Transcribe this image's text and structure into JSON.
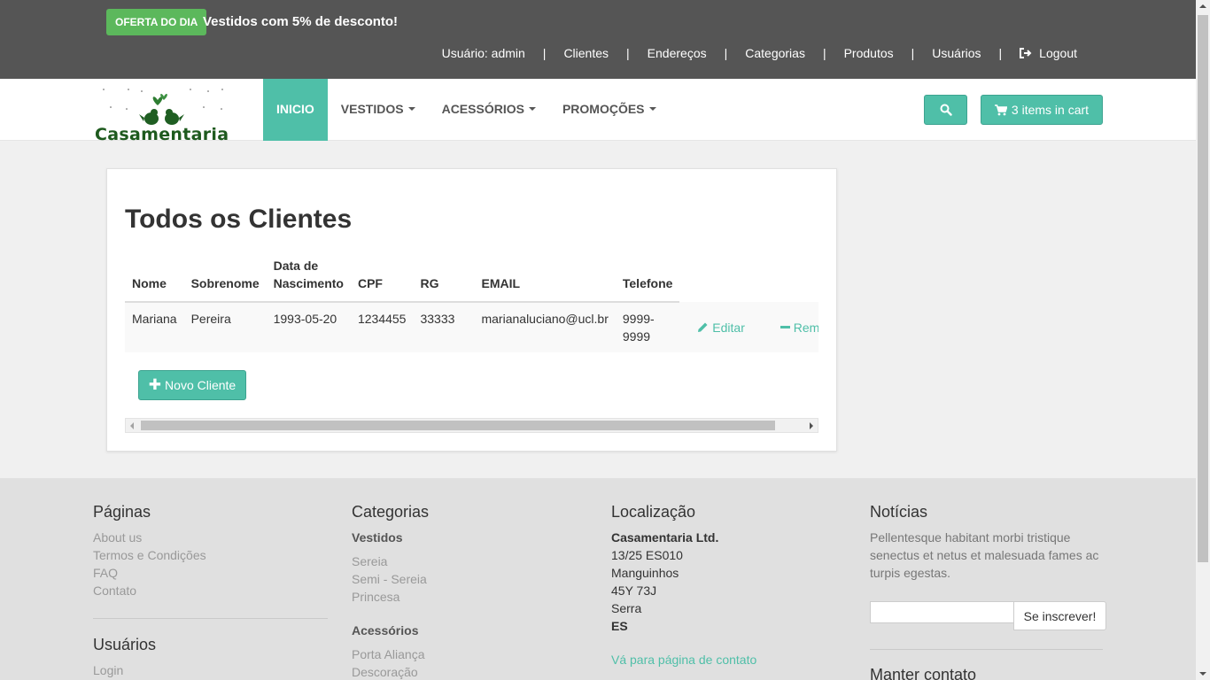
{
  "top_bar": {
    "offer_badge": "OFERTA DO DIA",
    "offer_text": "Vestidos com 5% de desconto!",
    "user_label": "Usuário: admin",
    "links": [
      "Clientes",
      "Endereços",
      "Categorias",
      "Produtos",
      "Usuários"
    ],
    "logout": "Logout"
  },
  "navbar": {
    "logo_text": "Casamentaria",
    "menu": [
      {
        "label": "INICIO",
        "active": true,
        "dropdown": false
      },
      {
        "label": "VESTIDOS",
        "active": false,
        "dropdown": true
      },
      {
        "label": "ACESSÓRIOS",
        "active": false,
        "dropdown": true
      },
      {
        "label": "PROMOÇÕES",
        "active": false,
        "dropdown": true
      }
    ],
    "search_icon": "search-icon",
    "cart_label": "3 items in cart",
    "cart_icon": "cart-icon"
  },
  "main": {
    "title": "Todos os Clientes",
    "table": {
      "headers": [
        "Nome",
        "Sobrenome",
        "Data de Nascimento",
        "CPF",
        "RG",
        "EMAIL",
        "Telefone"
      ],
      "rows": [
        {
          "nome": "Mariana",
          "sobrenome": "Pereira",
          "data_nascimento": "1993-05-20",
          "cpf": "1234455",
          "rg": "33333",
          "email": "marianaluciano@ucl.br",
          "telefone": "9999-9999",
          "edit_label": "Editar",
          "remove_label": "Remover"
        }
      ]
    },
    "new_button": "Novo Cliente"
  },
  "footer": {
    "paginas": {
      "title": "Páginas",
      "links": [
        "About us",
        "Termos e Condições",
        "FAQ",
        "Contato"
      ]
    },
    "usuarios": {
      "title": "Usuários",
      "links": [
        "Login"
      ]
    },
    "categorias": {
      "title": "Categorias",
      "groups": [
        {
          "name": "Vestidos",
          "items": [
            "Sereia",
            "Semi - Sereia",
            "Princesa"
          ]
        },
        {
          "name": "Acessórios",
          "items": [
            "Porta Aliança",
            "Descoração"
          ]
        }
      ]
    },
    "localizacao": {
      "title": "Localização",
      "company": "Casamentaria Ltd.",
      "lines": [
        "13/25 ES010",
        "Manguinhos",
        "45Y 73J",
        "Serra"
      ],
      "state": "ES",
      "contact_link": "Vá para página de contato"
    },
    "noticias": {
      "title": "Notícias",
      "text": "Pellentesque habitant morbi tristique senectus et netus et malesuada fames ac turpis egestas.",
      "input_value": "",
      "subscribe_button": "Se inscrever!",
      "keep_contact_title": "Manter contato"
    }
  },
  "colors": {
    "accent": "#4fbfa8",
    "offer_green": "#5cb85c",
    "top_bar": "#555555",
    "footer_bg": "#e0e0e0"
  }
}
